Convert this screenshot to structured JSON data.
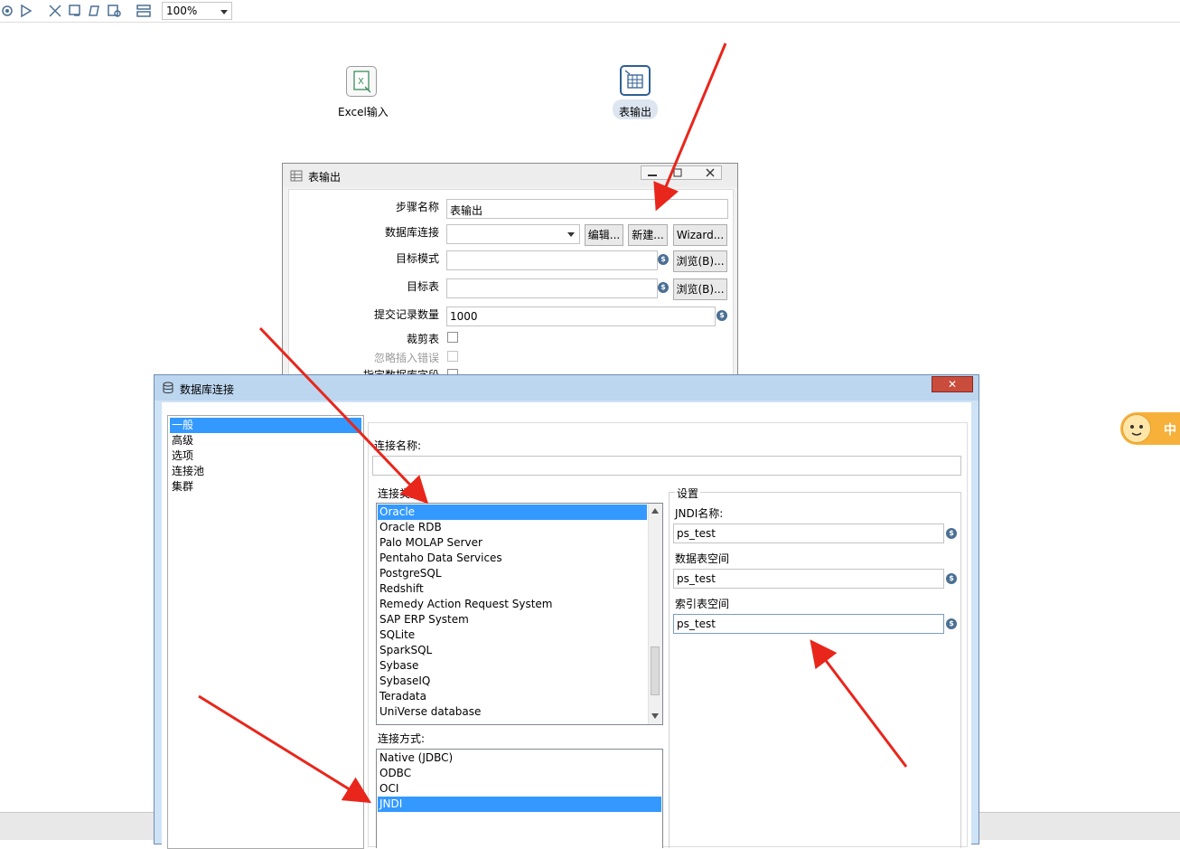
{
  "toolbar": {
    "zoom_value": "100%",
    "icons": [
      "run-icon",
      "play-icon",
      "debug-icon",
      "preview-icon",
      "replay-icon",
      "verify-icon",
      "explore-icon",
      "layout-icon"
    ]
  },
  "canvas": {
    "steps": [
      {
        "label": "Excel输入",
        "icon": "excel-icon"
      },
      {
        "label": "表输出",
        "icon": "table-output-icon"
      }
    ]
  },
  "table_output_dialog": {
    "title": "表输出",
    "step_name_label": "步骤名称",
    "step_name_value": "表输出",
    "db_connection_label": "数据库连接",
    "db_connection_value": "",
    "edit_button": "编辑...",
    "new_button": "新建...",
    "wizard_button": "Wizard...",
    "target_schema_label": "目标模式",
    "target_schema_value": "",
    "browse_schema_button": "浏览(B)...",
    "target_table_label": "目标表",
    "target_table_value": "",
    "browse_table_button": "浏览(B)...",
    "commit_size_label": "提交记录数量",
    "commit_size_value": "1000",
    "truncate_label": "裁剪表",
    "ignore_errors_label": "忽略插入错误",
    "specify_fields_label": "指定数据库字段",
    "var_symbol": "$"
  },
  "db_connection_dialog": {
    "title": "数据库连接",
    "close_symbol": "✕",
    "nav_items": [
      "一般",
      "高级",
      "选项",
      "连接池",
      "集群"
    ],
    "nav_selected_index": 0,
    "connection_name_label": "连接名称:",
    "connection_name_value": "",
    "connection_type_label": "连接类型:",
    "connection_types": [
      "Oracle",
      "Oracle RDB",
      "Palo MOLAP Server",
      "Pentaho Data Services",
      "PostgreSQL",
      "Redshift",
      "Remedy Action Request System",
      "SAP ERP System",
      "SQLite",
      "SparkSQL",
      "Sybase",
      "SybaseIQ",
      "Teradata",
      "UniVerse database"
    ],
    "connection_type_selected": "Oracle",
    "access_label": "连接方式:",
    "access_types": [
      "Native (JDBC)",
      "ODBC",
      "OCI",
      "JNDI"
    ],
    "access_selected": "JNDI",
    "settings_label": "设置",
    "jndi_name_label": "JNDI名称:",
    "jndi_name_value": "ps_test",
    "data_tablespace_label": "数据表空间",
    "data_tablespace_value": "ps_test",
    "index_tablespace_label": "索引表空间",
    "index_tablespace_value": "ps_test",
    "var_symbol": "$"
  },
  "ime": {
    "label": "中"
  },
  "colors": {
    "selection": "#3399ff",
    "annotation_arrow": "#e8261c",
    "dialog_frame": "#cfe3f6"
  }
}
